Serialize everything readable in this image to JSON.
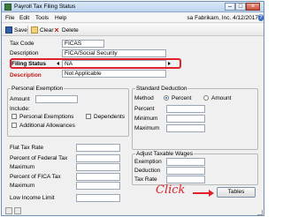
{
  "window": {
    "title": "Payroll Tax Filing Status"
  },
  "menu": {
    "items": [
      "File",
      "Edit",
      "Tools",
      "Help"
    ],
    "company_info": "sa  Fabrikam, Inc. 4/12/2017",
    "help_glyph": "?"
  },
  "toolbar": {
    "save": "Save",
    "clear": "Clear",
    "delete": "Delete"
  },
  "form": {
    "tax_code_label": "Tax Code",
    "tax_code_value": "FICAS",
    "description_label": "Description",
    "description_value": "FICA/Social Security",
    "filing_status_label": "Filing Status",
    "filing_status_value": "NA",
    "filing_description_label": "Description",
    "filing_description_value": "Not Applicable"
  },
  "personal_exemption": {
    "title": "Personal Exemption",
    "amount_label": "Amount",
    "include_label": "Include:",
    "personal_exemptions": "Personal Exemptions",
    "dependents": "Dependents",
    "additional_allowances": "Additional Allowances"
  },
  "standard_deduction": {
    "title": "Standard Deduction",
    "method_label": "Method",
    "percent_option": "Percent",
    "amount_option": "Amount",
    "selected": "Percent",
    "percent_label": "Percent",
    "minimum_label": "Minimum",
    "maximum_label": "Maximum"
  },
  "tax_fields": {
    "flat_tax_rate": "Flat Tax Rate",
    "percent_federal": "Percent of Federal Tax",
    "maximum_1": "Maximum",
    "percent_fica": "Percent of FICA Tax",
    "maximum_2": "Maximum",
    "low_income_limit": "Low Income Limit"
  },
  "adjust_wages": {
    "title": "Adjust Taxable Wages",
    "exemption": "Exemption",
    "deduction": "Deduction",
    "tax_rate": "Tax Rate"
  },
  "annotation": {
    "click": "Click"
  },
  "buttons": {
    "tables": "Tables"
  },
  "colors": {
    "highlight": "#e0202a",
    "title_bar": "#bcd3ee"
  }
}
